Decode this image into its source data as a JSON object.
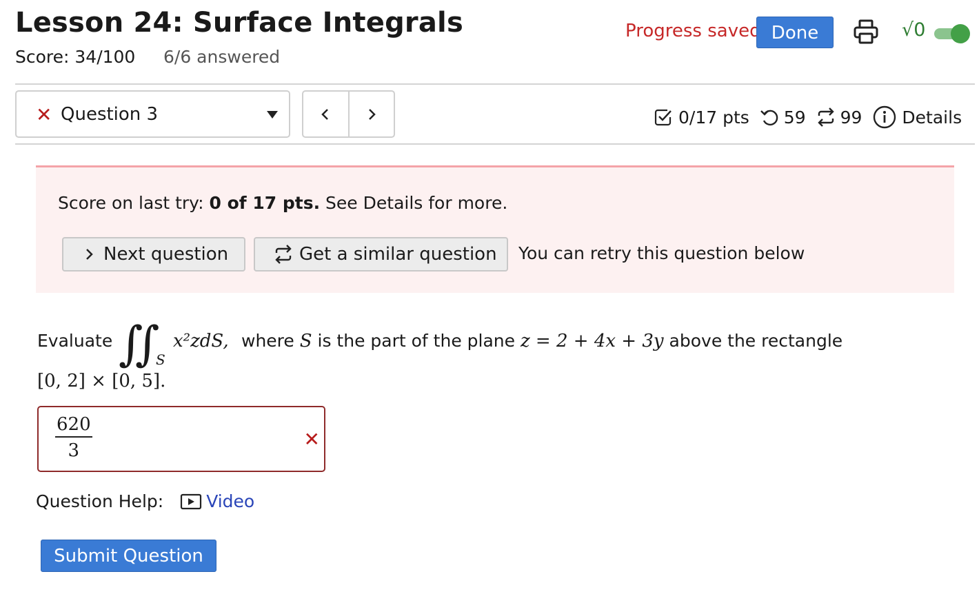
{
  "header": {
    "title": "Lesson 24: Surface Integrals",
    "score": "Score: 34/100",
    "answered": "6/6 answered",
    "progress_saved": "Progress saved",
    "done_label": "Done",
    "sqrt_glyph": "√0"
  },
  "question_nav": {
    "selected": "Question 3",
    "selected_status_icon": "x-mark-icon",
    "prev_label": "<",
    "next_label": ">"
  },
  "status_bar": {
    "points": "0/17 pts",
    "retries": "59",
    "similar": "99",
    "details_label": "Details"
  },
  "banner": {
    "score_prefix": "Score on last try: ",
    "score_value": "0 of 17 pts.",
    "score_suffix": " See Details for more.",
    "next_question_label": "Next question",
    "similar_question_label": "Get a similar question",
    "retry_text": "You can retry this question below"
  },
  "problem": {
    "evaluate": "Evaluate",
    "integrand": "x²zdS,",
    "where": "where",
    "S": "S",
    "middle": "is the part of the plane",
    "plane_equation": "z = 2 + 4x + 3y",
    "tail": "above the rectangle",
    "rectangle": "[0, 2] × [0, 5]."
  },
  "answer": {
    "numerator": "620",
    "denominator": "3",
    "status_icon": "wrong-x-icon"
  },
  "help": {
    "label": "Question Help:",
    "video_label": "Video"
  },
  "submit_label": "Submit Question",
  "colors": {
    "primary_blue": "#3a7bd5",
    "error_red": "#c62828",
    "banner_bg": "#fdf1f1",
    "toggle_green": "#43a047",
    "link_blue": "#2a45b8"
  }
}
